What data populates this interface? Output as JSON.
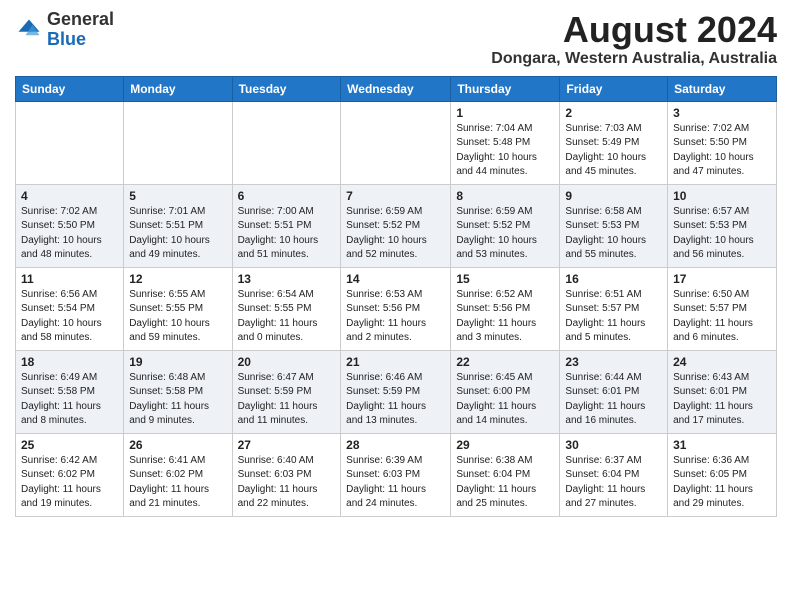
{
  "header": {
    "logo_general": "General",
    "logo_blue": "Blue",
    "month_year": "August 2024",
    "location": "Dongara, Western Australia, Australia"
  },
  "days_of_week": [
    "Sunday",
    "Monday",
    "Tuesday",
    "Wednesday",
    "Thursday",
    "Friday",
    "Saturday"
  ],
  "weeks": [
    [
      {
        "day": "",
        "info": ""
      },
      {
        "day": "",
        "info": ""
      },
      {
        "day": "",
        "info": ""
      },
      {
        "day": "",
        "info": ""
      },
      {
        "day": "1",
        "info": "Sunrise: 7:04 AM\nSunset: 5:48 PM\nDaylight: 10 hours\nand 44 minutes."
      },
      {
        "day": "2",
        "info": "Sunrise: 7:03 AM\nSunset: 5:49 PM\nDaylight: 10 hours\nand 45 minutes."
      },
      {
        "day": "3",
        "info": "Sunrise: 7:02 AM\nSunset: 5:50 PM\nDaylight: 10 hours\nand 47 minutes."
      }
    ],
    [
      {
        "day": "4",
        "info": "Sunrise: 7:02 AM\nSunset: 5:50 PM\nDaylight: 10 hours\nand 48 minutes."
      },
      {
        "day": "5",
        "info": "Sunrise: 7:01 AM\nSunset: 5:51 PM\nDaylight: 10 hours\nand 49 minutes."
      },
      {
        "day": "6",
        "info": "Sunrise: 7:00 AM\nSunset: 5:51 PM\nDaylight: 10 hours\nand 51 minutes."
      },
      {
        "day": "7",
        "info": "Sunrise: 6:59 AM\nSunset: 5:52 PM\nDaylight: 10 hours\nand 52 minutes."
      },
      {
        "day": "8",
        "info": "Sunrise: 6:59 AM\nSunset: 5:52 PM\nDaylight: 10 hours\nand 53 minutes."
      },
      {
        "day": "9",
        "info": "Sunrise: 6:58 AM\nSunset: 5:53 PM\nDaylight: 10 hours\nand 55 minutes."
      },
      {
        "day": "10",
        "info": "Sunrise: 6:57 AM\nSunset: 5:53 PM\nDaylight: 10 hours\nand 56 minutes."
      }
    ],
    [
      {
        "day": "11",
        "info": "Sunrise: 6:56 AM\nSunset: 5:54 PM\nDaylight: 10 hours\nand 58 minutes."
      },
      {
        "day": "12",
        "info": "Sunrise: 6:55 AM\nSunset: 5:55 PM\nDaylight: 10 hours\nand 59 minutes."
      },
      {
        "day": "13",
        "info": "Sunrise: 6:54 AM\nSunset: 5:55 PM\nDaylight: 11 hours\nand 0 minutes."
      },
      {
        "day": "14",
        "info": "Sunrise: 6:53 AM\nSunset: 5:56 PM\nDaylight: 11 hours\nand 2 minutes."
      },
      {
        "day": "15",
        "info": "Sunrise: 6:52 AM\nSunset: 5:56 PM\nDaylight: 11 hours\nand 3 minutes."
      },
      {
        "day": "16",
        "info": "Sunrise: 6:51 AM\nSunset: 5:57 PM\nDaylight: 11 hours\nand 5 minutes."
      },
      {
        "day": "17",
        "info": "Sunrise: 6:50 AM\nSunset: 5:57 PM\nDaylight: 11 hours\nand 6 minutes."
      }
    ],
    [
      {
        "day": "18",
        "info": "Sunrise: 6:49 AM\nSunset: 5:58 PM\nDaylight: 11 hours\nand 8 minutes."
      },
      {
        "day": "19",
        "info": "Sunrise: 6:48 AM\nSunset: 5:58 PM\nDaylight: 11 hours\nand 9 minutes."
      },
      {
        "day": "20",
        "info": "Sunrise: 6:47 AM\nSunset: 5:59 PM\nDaylight: 11 hours\nand 11 minutes."
      },
      {
        "day": "21",
        "info": "Sunrise: 6:46 AM\nSunset: 5:59 PM\nDaylight: 11 hours\nand 13 minutes."
      },
      {
        "day": "22",
        "info": "Sunrise: 6:45 AM\nSunset: 6:00 PM\nDaylight: 11 hours\nand 14 minutes."
      },
      {
        "day": "23",
        "info": "Sunrise: 6:44 AM\nSunset: 6:01 PM\nDaylight: 11 hours\nand 16 minutes."
      },
      {
        "day": "24",
        "info": "Sunrise: 6:43 AM\nSunset: 6:01 PM\nDaylight: 11 hours\nand 17 minutes."
      }
    ],
    [
      {
        "day": "25",
        "info": "Sunrise: 6:42 AM\nSunset: 6:02 PM\nDaylight: 11 hours\nand 19 minutes."
      },
      {
        "day": "26",
        "info": "Sunrise: 6:41 AM\nSunset: 6:02 PM\nDaylight: 11 hours\nand 21 minutes."
      },
      {
        "day": "27",
        "info": "Sunrise: 6:40 AM\nSunset: 6:03 PM\nDaylight: 11 hours\nand 22 minutes."
      },
      {
        "day": "28",
        "info": "Sunrise: 6:39 AM\nSunset: 6:03 PM\nDaylight: 11 hours\nand 24 minutes."
      },
      {
        "day": "29",
        "info": "Sunrise: 6:38 AM\nSunset: 6:04 PM\nDaylight: 11 hours\nand 25 minutes."
      },
      {
        "day": "30",
        "info": "Sunrise: 6:37 AM\nSunset: 6:04 PM\nDaylight: 11 hours\nand 27 minutes."
      },
      {
        "day": "31",
        "info": "Sunrise: 6:36 AM\nSunset: 6:05 PM\nDaylight: 11 hours\nand 29 minutes."
      }
    ]
  ]
}
